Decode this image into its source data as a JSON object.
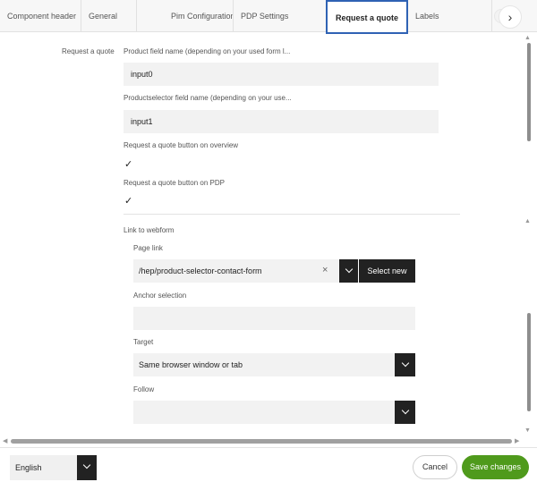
{
  "tabs": [
    {
      "label": "Component header",
      "active": false
    },
    {
      "label": "General",
      "active": false
    },
    {
      "label": "Pim Configuration",
      "active": false
    },
    {
      "label": "PDP Settings",
      "active": false
    },
    {
      "label": "Request a quote",
      "active": true
    },
    {
      "label": "Labels",
      "active": false
    }
  ],
  "tab_next_glyph": "›",
  "section": {
    "label": "Request a quote",
    "product_field": {
      "label": "Product field name (depending on your used form l...",
      "value": "input0"
    },
    "productselector_field": {
      "label": "Productselector field name (depending on your use...",
      "value": "input1"
    },
    "btn_overview": {
      "label": "Request a quote button on overview",
      "checked": true,
      "glyph": "✓"
    },
    "btn_pdp": {
      "label": "Request a quote button on PDP",
      "checked": true,
      "glyph": "✓"
    }
  },
  "webform": {
    "label": "Link to webform",
    "page_link": {
      "label": "Page link",
      "value": "/hep/product-selector-contact-form",
      "clear_glyph": "×",
      "select_new_label": "Select new"
    },
    "anchor": {
      "label": "Anchor selection",
      "value": ""
    },
    "target": {
      "label": "Target",
      "value": "Same browser window or tab"
    },
    "follow": {
      "label": "Follow",
      "value": ""
    }
  },
  "footer": {
    "language": "English",
    "cancel_label": "Cancel",
    "save_label": "Save changes"
  },
  "colors": {
    "accent_tab_border": "#2f62b4",
    "save_button": "#4f9a1c",
    "dark_button": "#222222"
  }
}
